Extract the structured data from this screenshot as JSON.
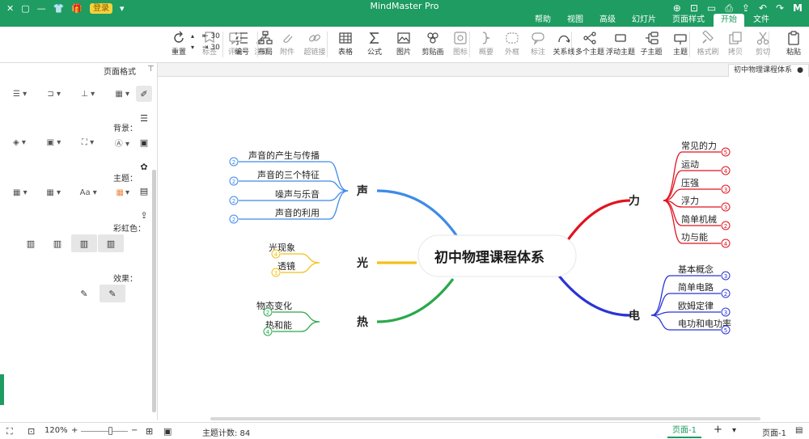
{
  "app": {
    "title": "MindMaster Pro",
    "brand_color": "#1e9c62",
    "badge": "登录"
  },
  "menu_tabs": [
    "开始",
    "页面样式",
    "幻灯片",
    "高级",
    "视图",
    "帮助"
  ],
  "menu_tab_file": "文件",
  "active_tab": "开始",
  "toolbar": {
    "items": [
      {
        "label": "粘贴",
        "icon": "paste-icon"
      },
      {
        "label": "剪切",
        "icon": "cut-icon"
      },
      {
        "label": "拷贝",
        "icon": "copy-icon"
      },
      {
        "label": "格式刷",
        "icon": "format-painter-icon"
      },
      {
        "label": "主题",
        "icon": "topic-icon"
      },
      {
        "label": "子主题",
        "icon": "subtopic-icon"
      },
      {
        "label": "浮动主题",
        "icon": "floating-topic-icon"
      },
      {
        "label": "多个主题",
        "icon": "multiple-topics-icon"
      },
      {
        "label": "关系线",
        "icon": "relationship-icon"
      },
      {
        "label": "标注",
        "icon": "callout-icon"
      },
      {
        "label": "外框",
        "icon": "boundary-icon"
      },
      {
        "label": "概要",
        "icon": "summary-icon"
      },
      {
        "label": "图标",
        "icon": "mark-icon"
      },
      {
        "label": "剪贴画",
        "icon": "clipart-icon"
      },
      {
        "label": "图片",
        "icon": "picture-icon"
      },
      {
        "label": "公式",
        "icon": "formula-icon"
      },
      {
        "label": "表格",
        "icon": "table-icon"
      },
      {
        "label": "超链接",
        "icon": "hyperlink-icon"
      },
      {
        "label": "附件",
        "icon": "attachment-icon"
      },
      {
        "label": "注释",
        "icon": "note-icon"
      },
      {
        "label": "评论",
        "icon": "comment-icon"
      },
      {
        "label": "标签",
        "icon": "tag-icon"
      },
      {
        "label": "布局",
        "icon": "layout-icon"
      },
      {
        "label": "编号",
        "icon": "numbering-icon"
      },
      {
        "label": "重置",
        "icon": "reset-icon"
      }
    ],
    "stepper_value_1": "30",
    "stepper_value_2": "30"
  },
  "doc_tab": {
    "title": "初中物理课程体系",
    "close": "●"
  },
  "left_panel": {
    "title": "页面格式",
    "sections": [
      "背景：",
      "主题：",
      "彩虹色：",
      "效果："
    ]
  },
  "mindmap": {
    "root": "初中物理课程体系",
    "branches": [
      {
        "name": "力",
        "color": "#e0141e",
        "children": [
          {
            "label": "常见的力",
            "badge": "5"
          },
          {
            "label": "运动",
            "badge": "4"
          },
          {
            "label": "压强",
            "badge": "3"
          },
          {
            "label": "浮力",
            "badge": "3"
          },
          {
            "label": "简单机械",
            "badge": "2"
          },
          {
            "label": "功与能",
            "badge": "4"
          }
        ]
      },
      {
        "name": "电",
        "color": "#2b34d6",
        "children": [
          {
            "label": "基本概念",
            "badge": "3"
          },
          {
            "label": "简单电路",
            "badge": "2"
          },
          {
            "label": "欧姆定律",
            "badge": "3"
          },
          {
            "label": "电功和电功率",
            "badge": "5"
          }
        ]
      },
      {
        "name": "声",
        "color": "#3d8be8",
        "children": [
          {
            "label": "声音的产生与传播",
            "badge": "2"
          },
          {
            "label": "声音的三个特征",
            "badge": "2"
          },
          {
            "label": "噪声与乐音",
            "badge": "2"
          },
          {
            "label": "声音的利用",
            "badge": "2"
          }
        ]
      },
      {
        "name": "光",
        "color": "#f5c017",
        "children": [
          {
            "label": "光现象",
            "badge": "4"
          },
          {
            "label": "透镜",
            "badge": "3"
          }
        ]
      },
      {
        "name": "热",
        "color": "#2ba84a",
        "children": [
          {
            "label": "物态变化",
            "badge": "2"
          },
          {
            "label": "热和能",
            "badge": "4"
          }
        ]
      }
    ]
  },
  "statusbar": {
    "page_label": "页面-1",
    "page_tab": "页面-1",
    "add": "+",
    "topic_count": "主题计数: 84",
    "zoom": "120%"
  }
}
